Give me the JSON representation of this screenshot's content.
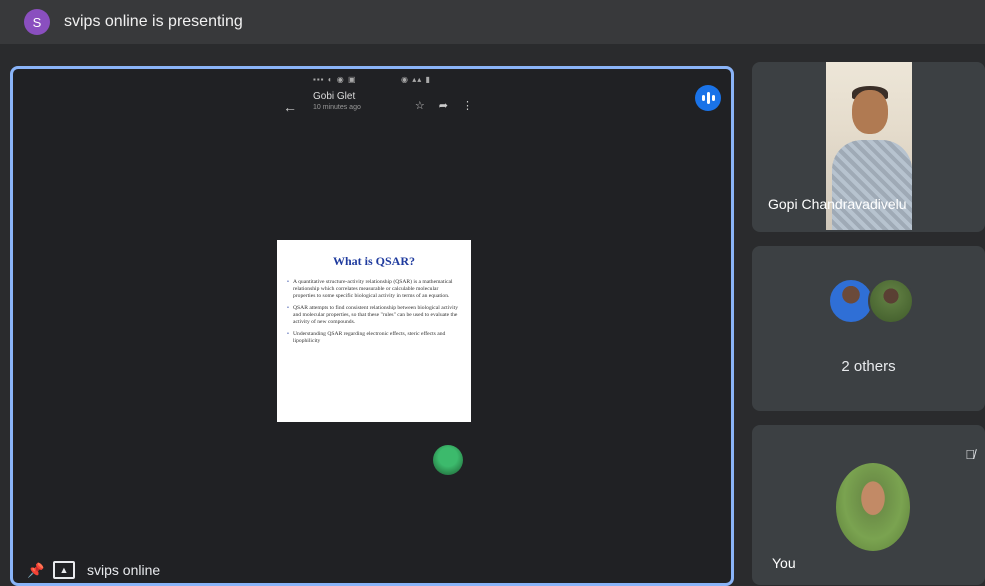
{
  "topbar": {
    "avatar_letter": "S",
    "title": "svips online is presenting"
  },
  "shared_screen": {
    "chat_name": "Gobi Glet",
    "chat_time": "10 minutes ago",
    "slide": {
      "title": "What is QSAR?",
      "bullets": [
        "A quantitative structure-activity relationship (QSAR) is a mathematical relationship which correlates measurable or calculable molecular properties to some specific biological activity in terms of an equation.",
        "QSAR attempts to find consistent relationship between biological activity and molecular properties, so that these \"rules\" can be used to evaluate the activity of new compounds.",
        "Understanding QSAR regarding electronic effects, steric effects and lipophilicity"
      ]
    }
  },
  "main_tile": {
    "presenter_name": "svips online",
    "icons": {
      "pin": "pin-icon",
      "present": "present-screen-icon",
      "speaking": "speaking-indicator-icon"
    }
  },
  "participants": {
    "tile1_name": "Gopi Chandravadivelu",
    "tile2_label": "2 others",
    "tile3_label": "You",
    "tile3_icon": "mic-off-icon"
  },
  "colors": {
    "active_border": "#8ab4f8",
    "speaking_badge": "#1a73e8",
    "avatar_s": "#8a4fbf"
  }
}
